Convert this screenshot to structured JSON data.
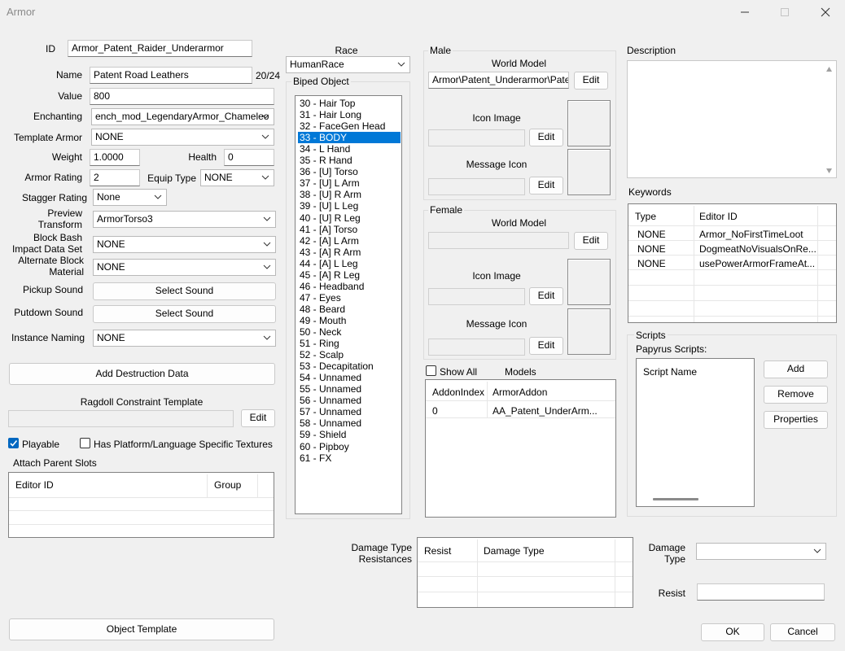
{
  "window": {
    "title": "Armor"
  },
  "form": {
    "id_label": "ID",
    "id_value": "Armor_Patent_Raider_Underarmor",
    "name_label": "Name",
    "name_value": "Patent Road Leathers",
    "name_count": "20/24",
    "value_label": "Value",
    "value_value": "800",
    "enchanting_label": "Enchanting",
    "enchanting_value": "ench_mod_LegendaryArmor_Chameleo",
    "template_armor_label": "Template Armor",
    "template_armor_value": "NONE",
    "weight_label": "Weight",
    "weight_value": "1.0000",
    "health_label": "Health",
    "health_value": "0",
    "armor_rating_label": "Armor Rating",
    "armor_rating_value": "2",
    "equip_type_label": "Equip Type",
    "equip_type_value": "NONE",
    "stagger_label": "Stagger Rating",
    "stagger_value": "None",
    "preview_label_1": "Preview",
    "preview_label_2": "Transform",
    "preview_value": "ArmorTorso3",
    "block_bash_label_1": "Block Bash",
    "block_bash_label_2": "Impact Data Set",
    "block_bash_value": "NONE",
    "alt_block_label_1": "Alternate Block",
    "alt_block_label_2": "Material",
    "alt_block_value": "NONE",
    "pickup_label": "Pickup Sound",
    "pickup_button": "Select Sound",
    "putdown_label": "Putdown Sound",
    "putdown_button": "Select Sound",
    "instance_label": "Instance Naming",
    "instance_value": "NONE",
    "add_destruction": "Add Destruction Data",
    "ragdoll_label": "Ragdoll Constraint Template",
    "ragdoll_edit": "Edit",
    "playable_label": "Playable",
    "platform_label": "Has Platform/Language Specific Textures",
    "attach_label": "Attach Parent Slots",
    "attach_col1": "Editor ID",
    "attach_col2": "Group",
    "object_template": "Object Template"
  },
  "race": {
    "label": "Race",
    "value": "HumanRace",
    "biped_label": "Biped Object",
    "biped_items": [
      "30 - Hair Top",
      "31 - Hair Long",
      "32 - FaceGen Head",
      "33 - BODY",
      "34 - L Hand",
      "35 - R Hand",
      "36 - [U] Torso",
      "37 - [U] L Arm",
      "38 - [U] R Arm",
      "39 - [U] L Leg",
      "40 - [U] R Leg",
      "41 - [A] Torso",
      "42 - [A] L Arm",
      "43 - [A] R Arm",
      "44 - [A] L Leg",
      "45 - [A] R Leg",
      "46 - Headband",
      "47 - Eyes",
      "48 - Beard",
      "49 - Mouth",
      "50 - Neck",
      "51 - Ring",
      "52 - Scalp",
      "53 - Decapitation",
      "54 - Unnamed",
      "55 - Unnamed",
      "56 - Unnamed",
      "57 - Unnamed",
      "58 - Unnamed",
      "59 - Shield",
      "60 - Pipboy",
      "61 - FX"
    ],
    "selected_index": 3
  },
  "male": {
    "label": "Male",
    "world_model_label": "World Model",
    "world_model_value": "Armor\\Patent_Underarmor\\Pater",
    "world_edit": "Edit",
    "icon_label": "Icon Image",
    "icon_edit": "Edit",
    "message_label": "Message Icon",
    "message_edit": "Edit"
  },
  "female": {
    "label": "Female",
    "world_model_label": "World Model",
    "world_edit": "Edit",
    "icon_label": "Icon Image",
    "icon_edit": "Edit",
    "message_label": "Message Icon",
    "message_edit": "Edit"
  },
  "models": {
    "show_all": "Show All",
    "label": "Models",
    "col1": "AddonIndex",
    "col2": "ArmorAddon",
    "rows": [
      {
        "index": "0",
        "addon": "AA_Patent_UnderArm..."
      }
    ]
  },
  "description": {
    "label": "Description"
  },
  "keywords": {
    "label": "Keywords",
    "col1": "Type",
    "col2": "Editor ID",
    "rows": [
      {
        "type": "NONE",
        "id": "Armor_NoFirstTimeLoot"
      },
      {
        "type": "NONE",
        "id": "DogmeatNoVisualsOnRe..."
      },
      {
        "type": "NONE",
        "id": "usePowerArmorFrameAt..."
      }
    ]
  },
  "scripts": {
    "label": "Scripts",
    "papyrus_label": "Papyrus Scripts:",
    "col1": "Script Name",
    "add": "Add",
    "remove": "Remove",
    "properties": "Properties"
  },
  "damage": {
    "label_1": "Damage Type",
    "label_2": "Resistances",
    "col1": "Resist",
    "col2": "Damage Type",
    "type_label_1": "Damage",
    "type_label_2": "Type",
    "resist_label": "Resist"
  },
  "footer": {
    "ok": "OK",
    "cancel": "Cancel"
  }
}
